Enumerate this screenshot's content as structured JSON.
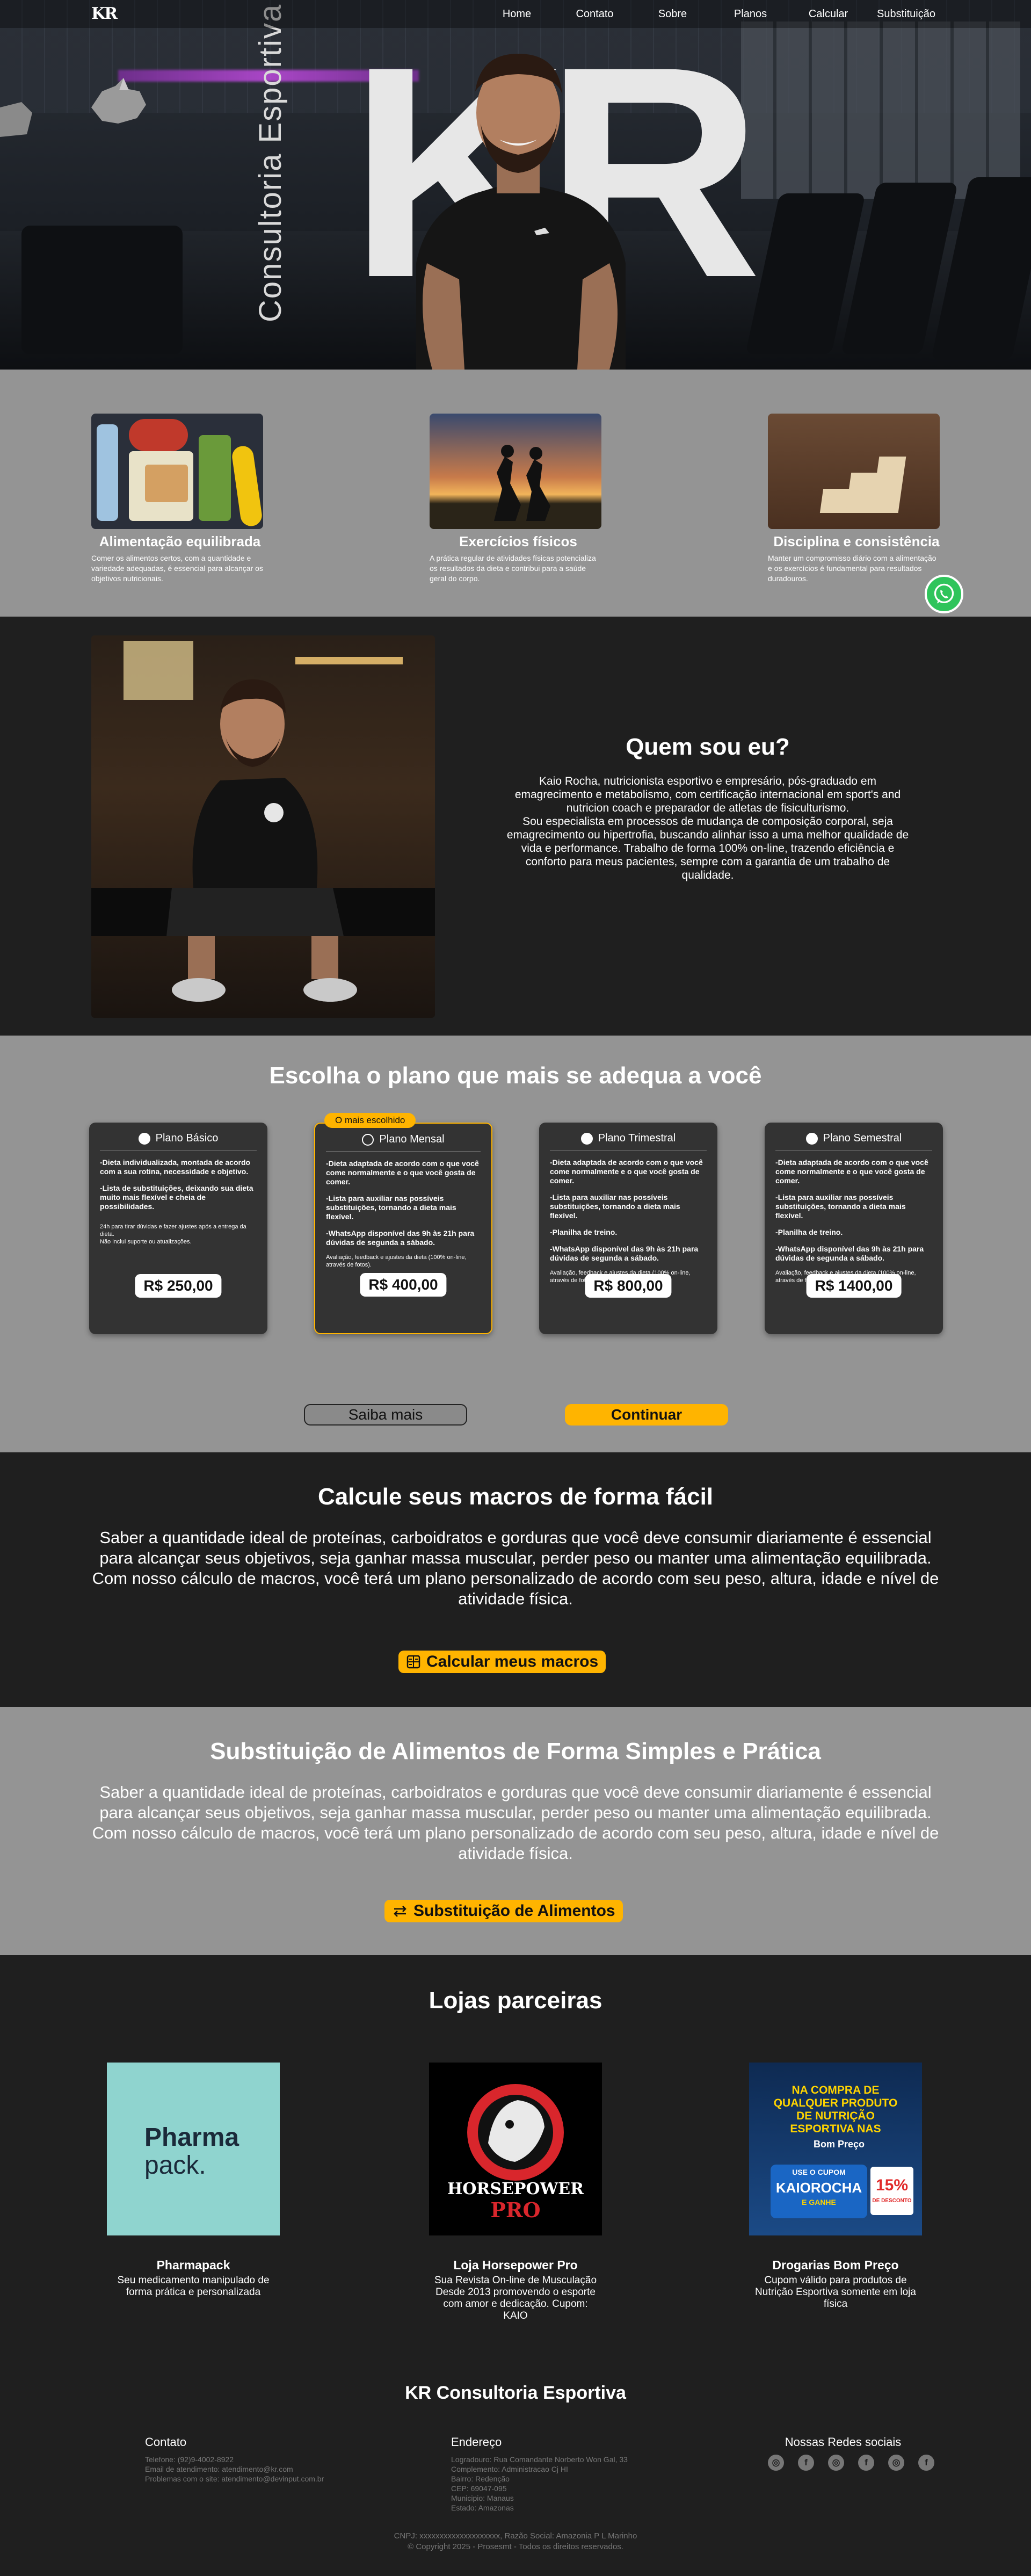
{
  "nav": {
    "logo": "KR",
    "items": [
      "Home",
      "Contato",
      "Sobre",
      "Planos",
      "Calcular",
      "Substituição"
    ]
  },
  "hero": {
    "big_letters": "KR",
    "vertical_text": "Consultoria Esportiva"
  },
  "features": [
    {
      "title": "Alimentação equilibrada",
      "text": "Comer os alimentos certos, com a quantidade e variedade adequadas, é essencial para alcançar os objetivos nutricionais."
    },
    {
      "title": "Exercícios físicos",
      "text": "A prática regular de atividades físicas potencializa os resultados da dieta e contribui para a saúde geral do corpo."
    },
    {
      "title": "Disciplina e consistência",
      "text": "Manter um compromisso diário com a alimentação e os exercícios é fundamental para resultados duradouros."
    }
  ],
  "about": {
    "title": "Quem sou eu?",
    "paragraph_1": "Kaio Rocha, nutricionista esportivo e empresário, pós-graduado em emagrecimento e metabolismo, com certificação internacional em sport's and nutricion coach e preparador de atletas de fisiculturismo.",
    "paragraph_2": "Sou especialista em processos de mudança de composição corporal, seja emagrecimento ou hipertrofia, buscando alinhar isso a uma melhor qualidade de vida e performance. Trabalho de forma 100% on-line, trazendo eficiência e conforto para meus pacientes, sempre com a garantia de um trabalho de qualidade."
  },
  "plans": {
    "title": "Escolha o plano que mais se adequa a você",
    "badge": "O mais escolhido",
    "items": [
      {
        "name": "Plano Básico",
        "features": [
          "-Dieta individualizada, montada de acordo com a sua rotina, necessidade e objetivo.",
          "-Lista de substituições, deixando sua dieta muito mais flexível e cheia de possibilidades."
        ],
        "note": "24h para tirar dúvidas e fazer ajustes após a entrega da dieta.\nNão inclui suporte ou atualizações.",
        "price": "R$ 250,00"
      },
      {
        "name": "Plano Mensal",
        "features": [
          "-Dieta adaptada de acordo com o que você come normalmente e o que você gosta de comer.",
          "-Lista para auxiliar nas possíveis substituições, tornando a dieta mais flexível.",
          "-WhatsApp disponível das 9h às 21h para dúvidas de segunda a sábado."
        ],
        "note": "Avaliação, feedback e ajustes da dieta (100% on-line, através de fotos).",
        "price": "R$ 400,00"
      },
      {
        "name": "Plano Trimestral",
        "features": [
          "-Dieta adaptada de acordo com o que você come normalmente e o que você gosta de comer.",
          "-Lista para auxiliar nas possíveis substituições, tornando a dieta mais flexível.",
          "-Planilha de treino.",
          "-WhatsApp disponível das 9h às 21h para dúvidas de segunda a sábado."
        ],
        "note": "Avaliação, feedback e ajustes da dieta (100% on-line, através de fotos).",
        "price": "R$ 800,00"
      },
      {
        "name": "Plano Semestral",
        "features": [
          "-Dieta adaptada de acordo com o que você come normalmente e o que você gosta de comer.",
          "-Lista para auxiliar nas possíveis substituições, tornando a dieta mais flexível.",
          "-Planilha de treino.",
          "-WhatsApp disponível das 9h às 21h para dúvidas de segunda a sábado."
        ],
        "note": "Avaliação, feedback e ajustes da dieta (100% on-line, através de fotos).",
        "price": "R$ 1400,00"
      }
    ],
    "saiba_mais": "Saiba mais",
    "continuar": "Continuar"
  },
  "macros": {
    "title": "Calcule seus macros de forma fácil",
    "text": "Saber a quantidade ideal de proteínas, carboidratos e gorduras que você deve consumir diariamente é essencial para alcançar seus objetivos, seja ganhar massa muscular, perder peso ou manter uma alimentação equilibrada. Com nosso cálculo de macros, você terá um plano personalizado de acordo com seu peso, altura, idade e nível de atividade física.",
    "button": "Calcular meus macros"
  },
  "substitution": {
    "title": "Substituição de Alimentos de Forma Simples e Prática",
    "text": "Saber a quantidade ideal de proteínas, carboidratos e gorduras que você deve consumir diariamente é essencial para alcançar seus objetivos, seja ganhar massa muscular, perder peso ou manter uma alimentação equilibrada. Com nosso cálculo de macros, você terá um plano personalizado de acordo com seu peso, altura, idade e nível de atividade física.",
    "button": "Substituição de Alimentos"
  },
  "partners": {
    "title": "Lojas parceiras",
    "items": [
      {
        "name": "Pharmapack",
        "desc": "Seu medicamento manipulado de forma prática e personalizada",
        "logo_line1": "Pharma",
        "logo_line2": "pack."
      },
      {
        "name": "Loja Horsepower Pro",
        "desc": "Sua Revista On-line de Musculação Desde 2013 promovendo o esporte com amor e dedicação. Cupom: KAIO",
        "logo_line1": "HORSEPOWER",
        "logo_line2": "PRO"
      },
      {
        "name": "Drogarias Bom Preço",
        "desc": "Cupom válido para produtos de Nutrição Esportiva somente em loja física",
        "logo_line1": "NA COMPRA DE QUALQUER PRODUTO DE NUTRIÇÃO ESPORTIVA NAS",
        "logo_brand": "Bom Preço",
        "logo_coupon_label": "USE O CUPOM",
        "logo_coupon": "KAIOROCHA",
        "logo_ganhe": "E GANHE",
        "logo_discount": "15%",
        "logo_discount_label": "DE DESCONTO"
      }
    ]
  },
  "footer": {
    "title": "KR Consultoria Esportiva",
    "contato": {
      "title": "Contato",
      "lines": [
        "Telefone: (92)9-4002-8922",
        "Email de atendimento: atendimento@kr.com",
        "Problemas com o site: atendimento@devinput.com.br"
      ]
    },
    "endereco": {
      "title": "Endereço",
      "lines": [
        "Logradouro: Rua Comandante Norberto Won Gal, 33",
        "Complemento: Administracao Cj HI",
        "Bairro: Redenção",
        "CEP: 69047-095",
        "Municipio: Manaus",
        "Estado: Amazonas"
      ]
    },
    "redes": {
      "title": "Nossas Redes sociais",
      "icons": [
        "instagram-icon",
        "facebook-icon",
        "instagram-icon",
        "facebook-icon",
        "instagram-icon",
        "facebook-icon"
      ]
    },
    "legal_1": "CNPJ: xxxxxxxxxxxxxxxxxxxx,  Razão Social: Amazonia P L Marinho",
    "legal_2": "© Copyright 2025 - Prosesmt - Todos os direitos reservados."
  },
  "colors": {
    "accent": "#ffb400",
    "dark": "#1f1f1f",
    "gray": "#949494",
    "card": "#333333",
    "whatsapp": "#2fc45b"
  }
}
